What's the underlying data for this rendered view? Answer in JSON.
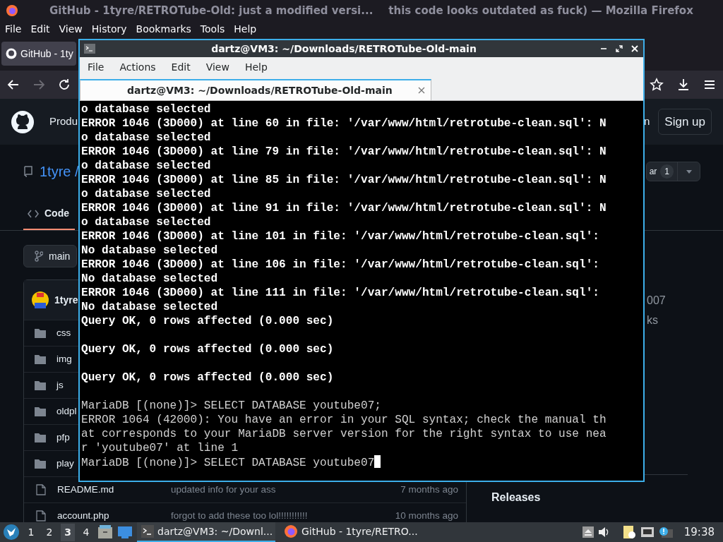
{
  "browser": {
    "title_parts": [
      "GitHub - 1tyre/RETROTube-Old: just a modified versi...",
      "this code looks outdated as fuck) — Mozilla Firefox"
    ],
    "menu": [
      "File",
      "Edit",
      "View",
      "History",
      "Bookmarks",
      "Tools",
      "Help"
    ],
    "tabs": [
      {
        "label": "GitHub - 1ty",
        "selected": true
      }
    ],
    "nav": {
      "forward_disabled": true
    },
    "page": {
      "header": {
        "nav_item": "Produ",
        "signin_part": "n",
        "signup": "Sign up"
      },
      "repo": {
        "owner": "1tyre /",
        "star_part": "ar",
        "star_count": "1"
      },
      "code_tab": {
        "label": "Code",
        "selected": true
      },
      "branch": "main",
      "commit_author": "1tyre",
      "files": [
        {
          "kind": "folder",
          "name": "css"
        },
        {
          "kind": "folder",
          "name": "img"
        },
        {
          "kind": "folder",
          "name": "js"
        },
        {
          "kind": "folder",
          "name": "oldpl"
        },
        {
          "kind": "folder",
          "name": "pfp"
        },
        {
          "kind": "folder",
          "name": "play"
        },
        {
          "kind": "file",
          "name": "README.md",
          "message": "updated info for your ass",
          "time": "7 months ago"
        },
        {
          "kind": "file",
          "name": "account.php",
          "message": "forgot to add these too lol!!!!!!!!!!!",
          "time": "10 months ago"
        }
      ],
      "about_parts": [
        "007",
        "ks"
      ],
      "releases": "Releases"
    }
  },
  "terminal": {
    "title": "dartz@VM3: ~/Downloads/RETROTube-Old-main",
    "menu": [
      "File",
      "Actions",
      "Edit",
      "View",
      "Help"
    ],
    "tabs": [
      {
        "label": "dartz@VM3: ~/Downloads/RETROTube-Old-main",
        "selected": true
      }
    ],
    "lines": [
      {
        "kind": "bold",
        "text": "o database selected"
      },
      {
        "kind": "bold",
        "text": "ERROR 1046 (3D000) at line 60 in file: '/var/www/html/retrotube-clean.sql': N"
      },
      {
        "kind": "bold",
        "text": "o database selected"
      },
      {
        "kind": "bold",
        "text": "ERROR 1046 (3D000) at line 79 in file: '/var/www/html/retrotube-clean.sql': N"
      },
      {
        "kind": "bold",
        "text": "o database selected"
      },
      {
        "kind": "bold",
        "text": "ERROR 1046 (3D000) at line 85 in file: '/var/www/html/retrotube-clean.sql': N"
      },
      {
        "kind": "bold",
        "text": "o database selected"
      },
      {
        "kind": "bold",
        "text": "ERROR 1046 (3D000) at line 91 in file: '/var/www/html/retrotube-clean.sql': N"
      },
      {
        "kind": "bold",
        "text": "o database selected"
      },
      {
        "kind": "bold",
        "text": "ERROR 1046 (3D000) at line 101 in file: '/var/www/html/retrotube-clean.sql':"
      },
      {
        "kind": "bold",
        "text": "No database selected"
      },
      {
        "kind": "bold",
        "text": "ERROR 1046 (3D000) at line 106 in file: '/var/www/html/retrotube-clean.sql':"
      },
      {
        "kind": "bold",
        "text": "No database selected"
      },
      {
        "kind": "bold",
        "text": "ERROR 1046 (3D000) at line 111 in file: '/var/www/html/retrotube-clean.sql':"
      },
      {
        "kind": "bold",
        "text": "No database selected"
      },
      {
        "kind": "bold",
        "text": "Query OK, 0 rows affected (0.000 sec)"
      },
      {
        "kind": "blank"
      },
      {
        "kind": "bold",
        "text": "Query OK, 0 rows affected (0.000 sec)"
      },
      {
        "kind": "blank"
      },
      {
        "kind": "bold",
        "text": "Query OK, 0 rows affected (0.000 sec)"
      },
      {
        "kind": "blank"
      },
      {
        "kind": "normal",
        "text": "MariaDB [(none)]> SELECT DATABASE youtube07;"
      },
      {
        "kind": "normal",
        "text": "ERROR 1064 (42000): You have an error in your SQL syntax; check the manual th"
      },
      {
        "kind": "normal",
        "text": "at corresponds to your MariaDB server version for the right syntax to use nea"
      },
      {
        "kind": "normal",
        "text": "r 'youtube07' at line 1"
      },
      {
        "kind": "input",
        "text": "MariaDB [(none)]> SELECT DATABASE youtube07"
      }
    ]
  },
  "taskbar": {
    "workspaces": [
      {
        "label": "1",
        "selected": false
      },
      {
        "label": "2",
        "selected": false
      },
      {
        "label": "3",
        "selected": true
      },
      {
        "label": "4",
        "selected": false
      }
    ],
    "tasks": [
      {
        "kind": "terminal",
        "label": "dartz@VM3: ~/Downl...",
        "selected": true
      },
      {
        "kind": "firefox",
        "label": "GitHub - 1tyre/RETRO...",
        "selected": false
      }
    ],
    "clock": "19:38"
  }
}
